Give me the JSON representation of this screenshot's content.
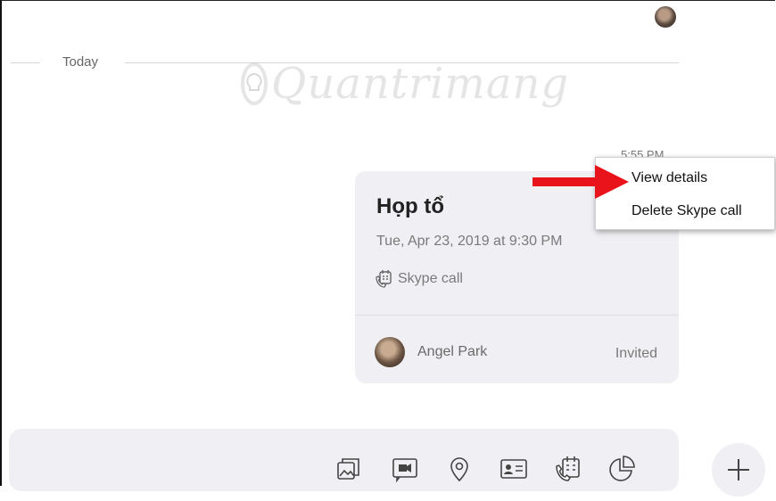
{
  "conversation": {
    "date_divider": "Today",
    "watermark": "Quantrimang"
  },
  "message": {
    "time": "5:55 PM",
    "title": "Họp tổ",
    "datetime": "Tue, Apr 23, 2019 at 9:30 PM",
    "call_type_icon": "calendar-phone-icon",
    "call_type": "Skype call",
    "attendee": {
      "name": "Angel Park",
      "status": "Invited"
    }
  },
  "context_menu": {
    "items": [
      {
        "label": "View details"
      },
      {
        "label": "Delete Skype call"
      }
    ]
  },
  "composer": {
    "tools": [
      "media-gallery-icon",
      "video-message-icon",
      "location-icon",
      "contact-card-icon",
      "schedule-call-icon",
      "poll-icon"
    ],
    "add_icon": "plus-icon"
  },
  "colors": {
    "annotation_arrow": "#e8131b",
    "card_bg": "#f0f0f4"
  }
}
